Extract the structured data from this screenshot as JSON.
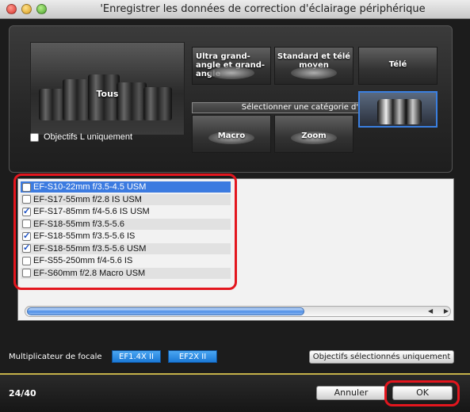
{
  "window": {
    "title": "'Enregistrer les données de correction d'éclairage périphérique"
  },
  "categories": {
    "all": "Tous",
    "ultra_wide": "Ultra grand-angle et grand-angle",
    "standard": "Standard et télé moyen",
    "tele": "Télé",
    "banner": "Sélectionner une catégorie d'objectif",
    "macro": "Macro",
    "zoom": "Zoom",
    "l_only_label": "Objectifs L uniquement",
    "selected": "lens-image"
  },
  "lens_list": [
    {
      "name": "EF-S10-22mm f/3.5-4.5 USM",
      "checked": false,
      "selected": true
    },
    {
      "name": "EF-S17-55mm f/2.8 IS USM",
      "checked": false,
      "selected": false
    },
    {
      "name": "EF-S17-85mm f/4-5.6 IS USM",
      "checked": true,
      "selected": false
    },
    {
      "name": "EF-S18-55mm f/3.5-5.6",
      "checked": false,
      "selected": false
    },
    {
      "name": "EF-S18-55mm f/3.5-5.6 IS",
      "checked": true,
      "selected": false
    },
    {
      "name": "EF-S18-55mm f/3.5-5.6 USM",
      "checked": true,
      "selected": false
    },
    {
      "name": "EF-S55-250mm f/4-5.6 IS",
      "checked": false,
      "selected": false
    },
    {
      "name": "EF-S60mm f/2.8 Macro USM",
      "checked": false,
      "selected": false
    }
  ],
  "multiplier": {
    "label": "Multiplicateur de focale",
    "ext1": "EF1.4X II",
    "ext2": "EF2X II",
    "selected_only": "Objectifs sélectionnés uniquement"
  },
  "footer": {
    "count": "24/40",
    "cancel": "Annuler",
    "ok": "OK"
  },
  "colors": {
    "highlight": "#e3161e",
    "selection": "#3c7be0",
    "extender": "#1b79d6"
  }
}
